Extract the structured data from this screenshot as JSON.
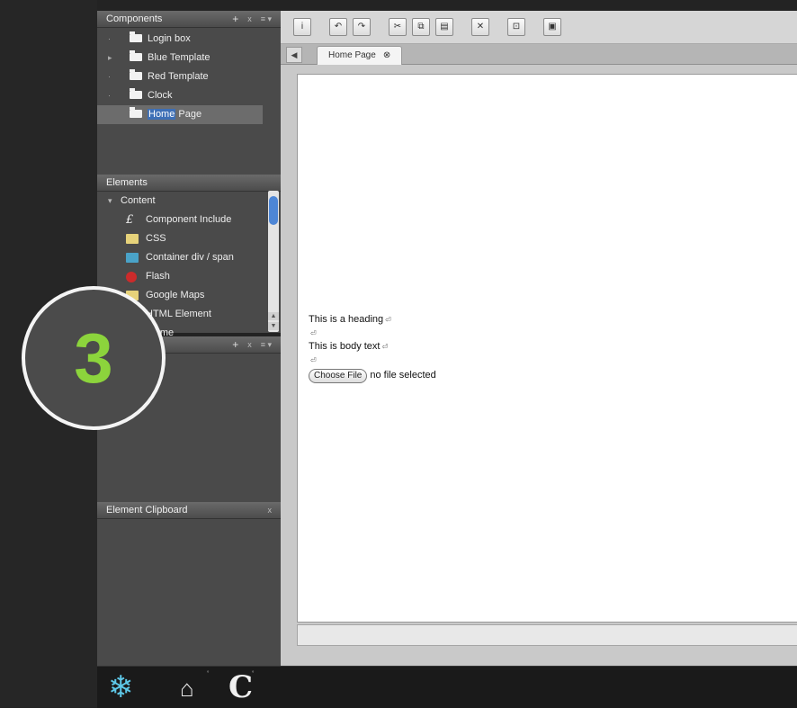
{
  "components": {
    "title": "Components",
    "items": [
      {
        "label": "Login box",
        "bullet": "·"
      },
      {
        "label": "Blue Template",
        "bullet": "▸"
      },
      {
        "label": "Red Template",
        "bullet": "·"
      },
      {
        "label": "Clock",
        "bullet": "·"
      }
    ],
    "selected": {
      "highlight": "Home",
      "rest": " Page"
    }
  },
  "elements": {
    "title": "Elements",
    "group": "Content",
    "items": [
      {
        "label": "Component Include",
        "icon": "script-icon",
        "color": "#e8e8e8"
      },
      {
        "label": "CSS",
        "icon": "css-icon",
        "color": "#e6d27a"
      },
      {
        "label": "Container div / span",
        "icon": "container-icon",
        "color": "#4aa3c8"
      },
      {
        "label": "Flash",
        "icon": "flash-icon",
        "color": "#cc2b2b"
      },
      {
        "label": "Google Maps",
        "icon": "map-icon",
        "color": "#e6d27a"
      },
      {
        "label": "HTML Element",
        "icon": "html-icon",
        "color": "#e8e8e8"
      },
      {
        "label": "Iframe",
        "icon": "iframe-icon",
        "color": "#e8e8e8"
      }
    ]
  },
  "clipboard": {
    "title": "Element Clipboard",
    "close": "x"
  },
  "icons": {
    "add": "+",
    "remove": "x",
    "menu": "≡ ▾",
    "close": "x"
  },
  "toolbar": {
    "buttons": [
      "i",
      "↶",
      "↷",
      "✂",
      "⧉",
      "▤",
      "✕",
      "⊡",
      "▣"
    ]
  },
  "editor": {
    "tab_label": "Home Page",
    "tab_close": "⊗",
    "tab_scroll": "◀",
    "heading": "This is a heading",
    "body_text": "This is body text",
    "para_mark": "⏎",
    "choose_file": "Choose File",
    "no_file": "no file selected"
  },
  "bottom_bar": {
    "snow": "❄",
    "home": "⌂",
    "c_label": "C",
    "sup": "˚"
  },
  "step": {
    "number": "3"
  },
  "colors": {
    "accent": "#8cd43c",
    "selection": "#3d6fb6",
    "scroll": "#4d86d6"
  }
}
